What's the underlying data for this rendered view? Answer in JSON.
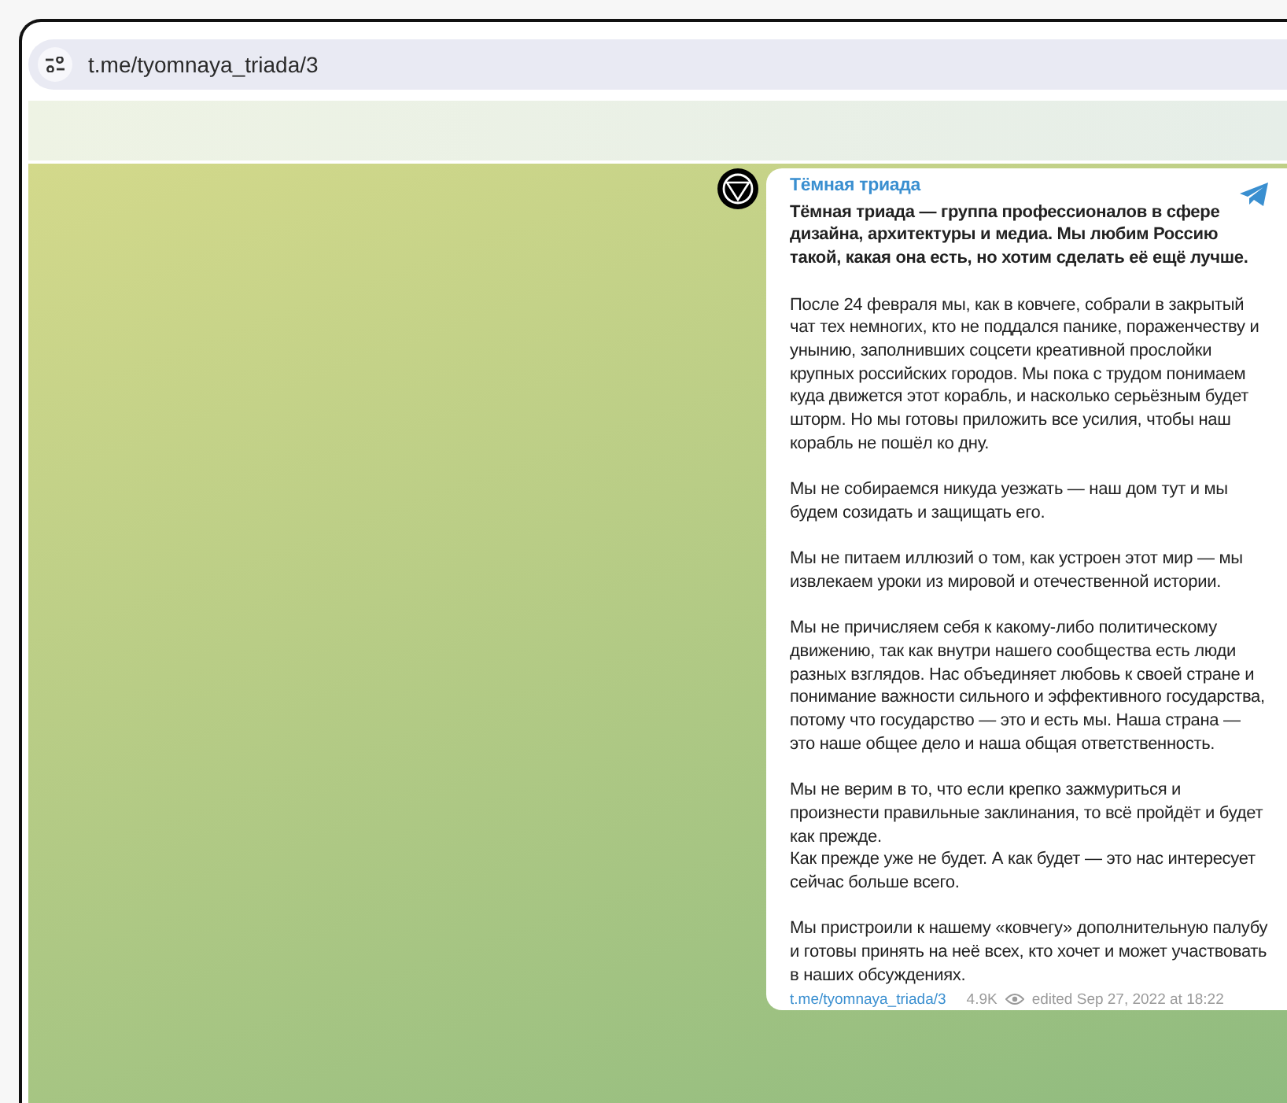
{
  "address_bar": {
    "url": "t.me/tyomnaya_triada/3"
  },
  "post": {
    "channel_name": "Тёмная триада",
    "paragraphs": [
      {
        "kind": "lead",
        "text": "Тёмная триада — группа профессионалов в сфере дизайна, архитектуры и медиа. Мы любим Россию такой, какая она есть, но хотим сделать её ещё лучше."
      },
      {
        "kind": "body",
        "text": "После 24 февраля мы, как в ковчеге, собрали в закрытый чат тех немногих, кто не поддался панике, пораженчеству и унынию, заполнивших соцсети креативной прослойки крупных российских городов. Мы пока с трудом понимаем куда движется этот корабль, и насколько серьёзным будет\nшторм. Но мы готовы приложить все усилия, чтобы наш корабль не пошёл ко дну."
      },
      {
        "kind": "body",
        "text": "Мы не собираемся никуда уезжать — наш дом тут и мы будем созидать и защищать его."
      },
      {
        "kind": "body",
        "text": "Мы не питаем иллюзий о том, как устроен этот мир — мы извлекаем уроки из мировой и отечественной истории."
      },
      {
        "kind": "body",
        "text": "Мы не причисляем себя к какому-либо политическому движению, так как внутри нашего сообщества есть люди разных взглядов. Нас объединяет любовь к своей стране и понимание важности сильного и эффективного государства, потому что государство — это и есть мы. Наша страна — это наше общее дело и наша общая ответственность."
      },
      {
        "kind": "body",
        "text": "Мы не верим в то, что если крепко зажмуриться и произнести правильные заклинания, то всё пройдёт и будет как прежде.\nКак прежде уже не будет. А как будет — это нас интересует сейчас больше всего."
      },
      {
        "kind": "body",
        "text": "Мы пристроили к нашему «ковчегу» дополнительную палубу и готовы принять на неё всех, кто хочет и может участвовать в наших обсуждениях."
      }
    ],
    "footer": {
      "link": "t.me/tyomnaya_triada/3",
      "views": "4.9K",
      "date": "edited Sep 27, 2022 at 18:22"
    }
  }
}
